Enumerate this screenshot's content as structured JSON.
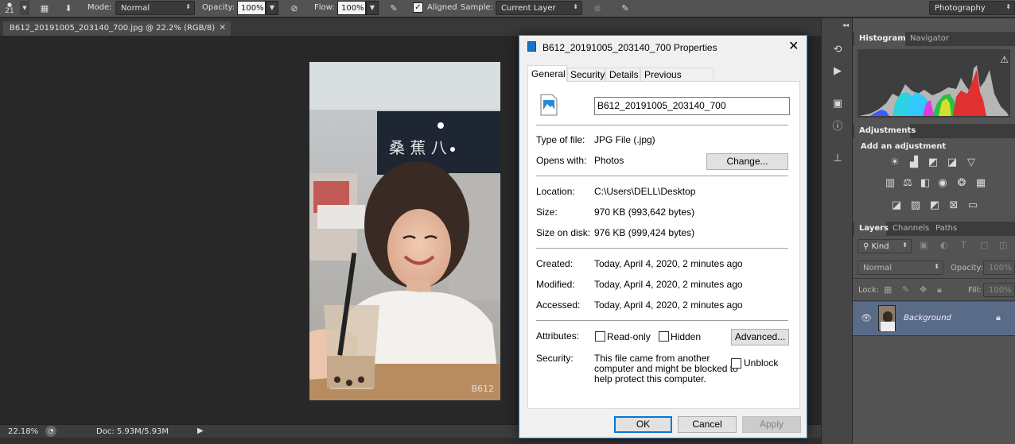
{
  "options_bar": {
    "brush_size": "21",
    "mode_label": "Mode:",
    "mode_value": "Normal",
    "opacity_label": "Opacity:",
    "opacity_value": "100%",
    "flow_label": "Flow:",
    "flow_value": "100%",
    "aligned_label": "Aligned",
    "sample_label": "Sample:",
    "sample_value": "Current Layer",
    "workspace": "Photography"
  },
  "document": {
    "tab_title": "B612_20191005_203140_700.jpg @ 22.2% (RGB/8)",
    "watermark": "B612",
    "sign_text": "桑 蕉 八"
  },
  "status_bar": {
    "zoom": "22.18%",
    "doc_info": "Doc: 5.93M/5.93M"
  },
  "panels": {
    "histogram_tab": "Histogram",
    "navigator_tab": "Navigator",
    "adjustments_tab": "Adjustments",
    "add_adjustment": "Add an adjustment",
    "layers_tab": "Layers",
    "channels_tab": "Channels",
    "paths_tab": "Paths",
    "kind_label": "Kind",
    "blend_mode": "Normal",
    "opacity_label": "Opacity:",
    "opacity_value": "100%",
    "lock_label": "Lock:",
    "fill_label": "Fill:",
    "fill_value": "100%",
    "layer_name": "Background"
  },
  "dialog": {
    "title": "B612_20191005_203140_700 Properties",
    "tabs": [
      "General",
      "Security",
      "Details",
      "Previous Versions"
    ],
    "filename": "B612_20191005_203140_700",
    "type_label": "Type of file:",
    "type_value": "JPG File (.jpg)",
    "opens_label": "Opens with:",
    "opens_value": "Photos",
    "change_button": "Change...",
    "location_label": "Location:",
    "location_value": "C:\\Users\\DELL\\Desktop",
    "size_label": "Size:",
    "size_value": "970 KB (993,642 bytes)",
    "size_disk_label": "Size on disk:",
    "size_disk_value": "976 KB (999,424 bytes)",
    "created_label": "Created:",
    "created_value": "Today, April 4, 2020, 2 minutes ago",
    "modified_label": "Modified:",
    "modified_value": "Today, April 4, 2020, 2 minutes ago",
    "accessed_label": "Accessed:",
    "accessed_value": "Today, April 4, 2020, 2 minutes ago",
    "attributes_label": "Attributes:",
    "readonly_label": "Read-only",
    "hidden_label": "Hidden",
    "advanced_button": "Advanced...",
    "security_label": "Security:",
    "security_text_1": "This file came from another",
    "security_text_2": "computer and might be blocked to",
    "security_text_3": "help protect this computer.",
    "unblock_label": "Unblock",
    "ok_button": "OK",
    "cancel_button": "Cancel",
    "apply_button": "Apply"
  },
  "colors": {
    "accent_blue": "#0078d7",
    "ps_panel": "#535353",
    "selected_layer": "#5a6b88"
  }
}
